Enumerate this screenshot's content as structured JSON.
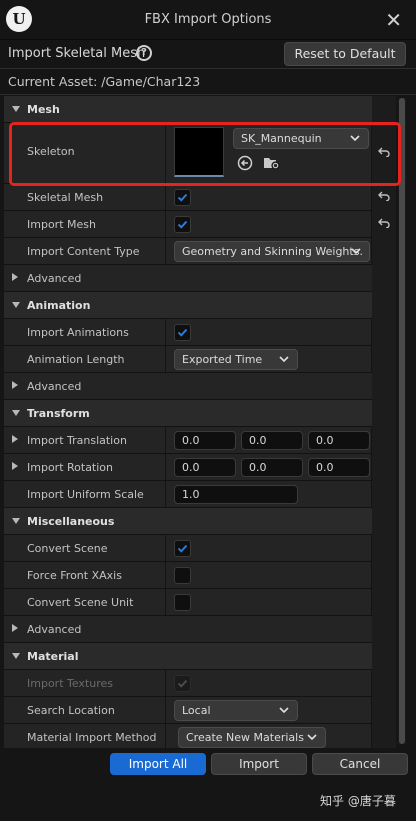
{
  "window": {
    "title": "FBX Import Options",
    "logo_letter": "U",
    "close_glyph": "✕"
  },
  "header": {
    "title": "Import Skeletal Mesh",
    "help_glyph": "?",
    "reset_label": "Reset to Default"
  },
  "asset": {
    "text": "Current Asset:  /Game/Char123"
  },
  "sections": {
    "mesh": {
      "label": "Mesh",
      "skeleton": {
        "label": "Skeleton",
        "value": "SK_Mannequin"
      },
      "skeletal_mesh": {
        "label": "Skeletal Mesh",
        "checked": true
      },
      "import_mesh": {
        "label": "Import Mesh",
        "checked": true
      },
      "content_type": {
        "label": "Import Content Type",
        "value": "Geometry and Skinning Weights."
      },
      "advanced": "Advanced"
    },
    "animation": {
      "label": "Animation",
      "import_animations": {
        "label": "Import Animations",
        "checked": true
      },
      "length": {
        "label": "Animation Length",
        "value": "Exported Time"
      },
      "advanced": "Advanced"
    },
    "transform": {
      "label": "Transform",
      "translation": {
        "label": "Import Translation",
        "x": "0.0",
        "y": "0.0",
        "z": "0.0"
      },
      "rotation": {
        "label": "Import Rotation",
        "x": "0.0",
        "y": "0.0",
        "z": "0.0"
      },
      "scale": {
        "label": "Import Uniform Scale",
        "value": "1.0"
      }
    },
    "misc": {
      "label": "Miscellaneous",
      "convert_scene": {
        "label": "Convert Scene",
        "checked": true
      },
      "force_front": {
        "label": "Force Front XAxis",
        "checked": false
      },
      "convert_unit": {
        "label": "Convert Scene Unit",
        "checked": false
      },
      "advanced": "Advanced"
    },
    "material": {
      "label": "Material",
      "import_textures": {
        "label": "Import Textures",
        "checked": true,
        "disabled": true
      },
      "search_location": {
        "label": "Search Location",
        "value": "Local"
      },
      "method": {
        "label": "Material Import Method",
        "value": "Create New Materials"
      }
    }
  },
  "footer": {
    "import_all": "Import All",
    "import": "Import",
    "cancel": "Cancel",
    "watermark": "知乎 @唐子暮"
  },
  "colors": {
    "accent": "#1a6ad4",
    "highlight": "#e8231e",
    "check": "#2f7fe0"
  }
}
